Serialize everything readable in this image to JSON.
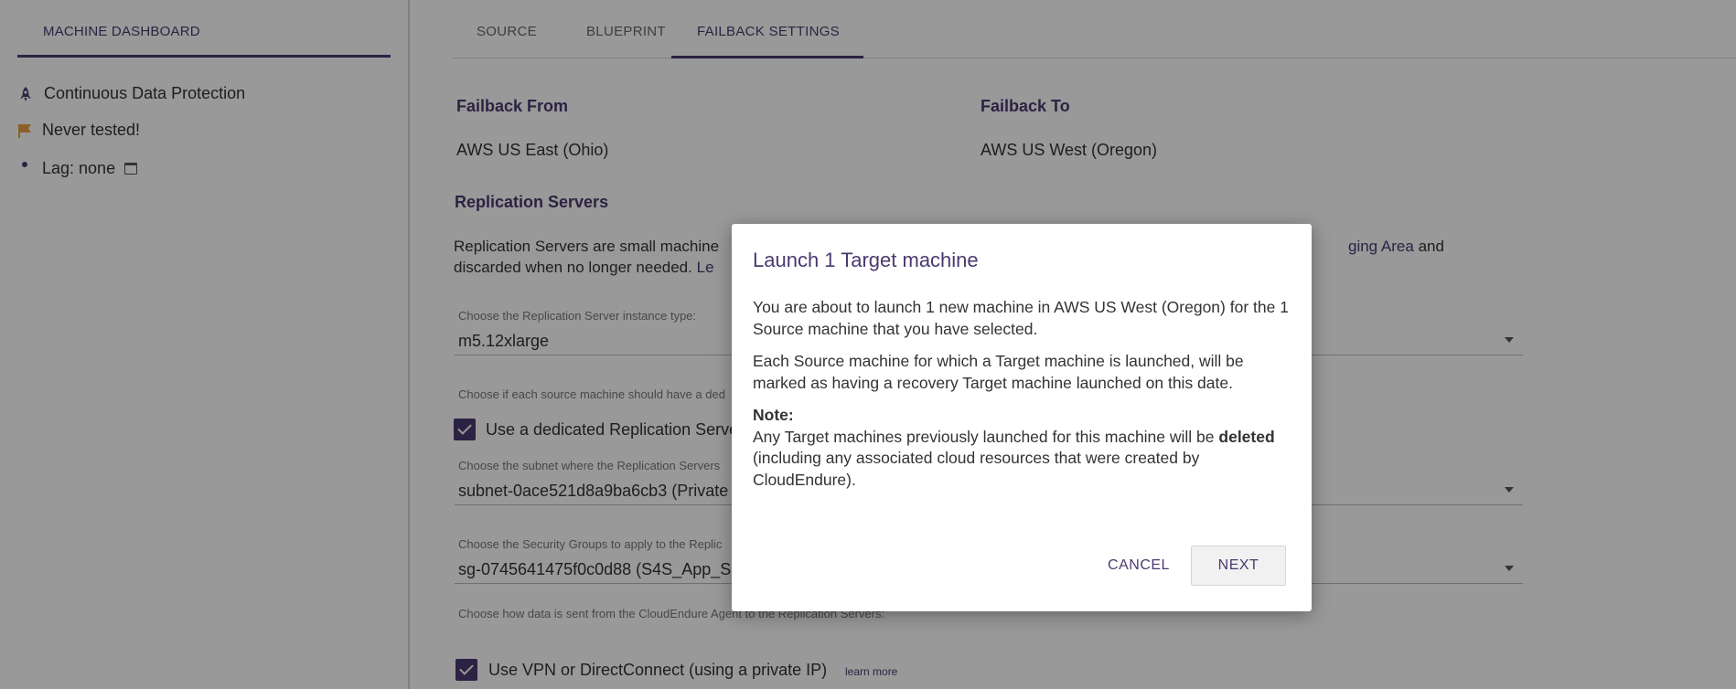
{
  "sidebar": {
    "tab_label": "MACHINE DASHBOARD",
    "status": {
      "cdp": "Continuous Data Protection",
      "tested": "Never tested!",
      "lag": "Lag: none"
    }
  },
  "tabs": {
    "source": "SOURCE",
    "blueprint": "BLUEPRINT",
    "failback": "FAILBACK SETTINGS"
  },
  "failback": {
    "from_label": "Failback From",
    "from_value": "AWS US East (Ohio)",
    "to_label": "Failback To",
    "to_value": "AWS US West (Oregon)"
  },
  "replication": {
    "heading": "Replication Servers",
    "para_start": "Replication Servers are small machine",
    "para_right_link": "ging Area",
    "para_right_end": " and",
    "para_line2": "discarded when no longer needed.",
    "para_link": "Le",
    "instance_label": "Choose the Replication Server instance type:",
    "instance_value": "m5.12xlarge",
    "dedicated_label": "Choose if each source machine should have a ded",
    "dedicated_checkbox": "Use a dedicated Replication Serve",
    "subnet_label": "Choose the subnet where the Replication Servers",
    "subnet_value": "subnet-0ace521d8a9ba6cb3 (Private",
    "sg_label": "Choose the Security Groups to apply to the Replic",
    "sg_value": "sg-0745641475f0c0d88 (S4S_App_S",
    "data_label": "Choose how data is sent from the CloudEndure Agent to the Replication Servers:",
    "vpn_checkbox": "Use VPN or DirectConnect (using a private IP)",
    "learn_more": "learn more"
  },
  "dialog": {
    "title": "Launch 1 Target machine",
    "p1": "You are about to launch 1 new machine in AWS US West (Oregon) for the 1 Source machine that you have selected.",
    "p2": "Each Source machine for which a Target machine is launched, will be marked as having a recovery Target machine launched on this date.",
    "note_label": "Note:",
    "note_pre": "Any Target machines previously launched for this machine will be ",
    "note_bold": "deleted",
    "note_post": " (including any associated cloud resources that were created by CloudEndure).",
    "cancel": "CANCEL",
    "next": "NEXT"
  },
  "colors": {
    "accent": "#4a3a70",
    "flag": "#e8a040",
    "overlay": "rgba(0,0,0,0.40)"
  }
}
